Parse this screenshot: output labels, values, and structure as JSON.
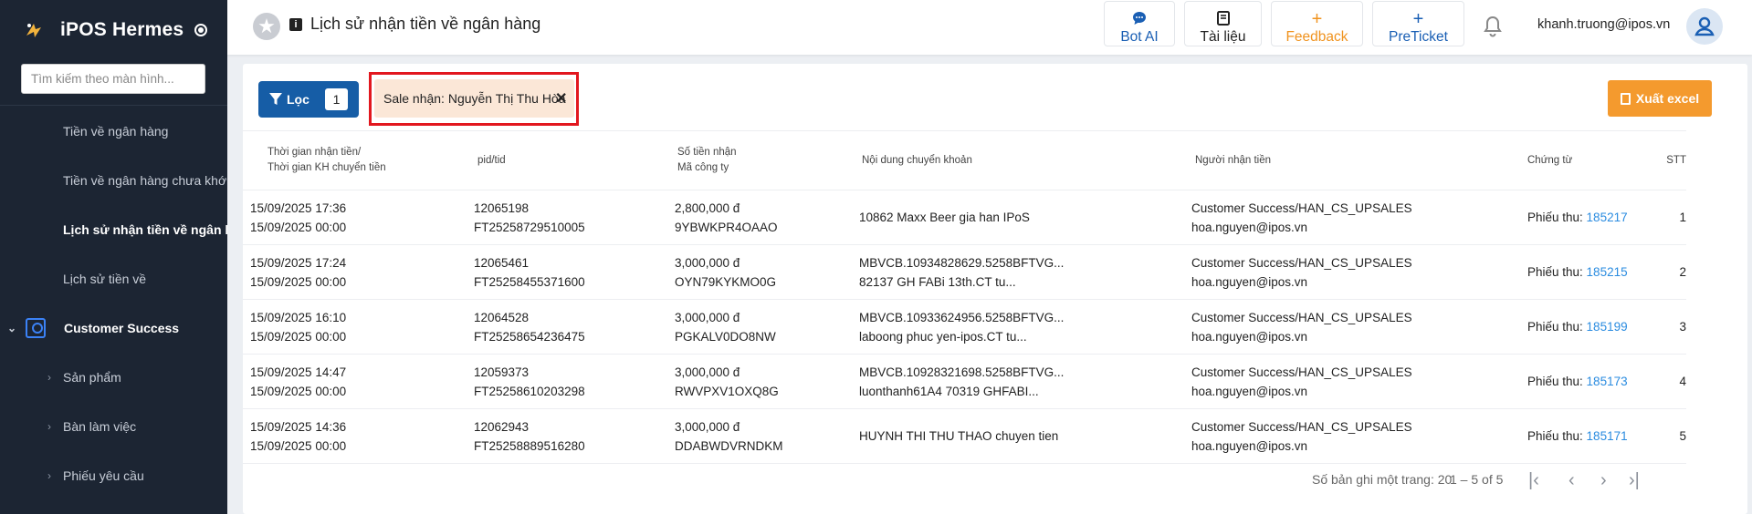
{
  "sidebar": {
    "brand": "iPOS Hermes",
    "search_placeholder": "Tìm kiếm theo màn hình...",
    "items": [
      {
        "label": "Tiền về ngân hàng"
      },
      {
        "label": "Tiền về ngân hàng chưa khớp"
      },
      {
        "label": "Lịch sử nhận tiền về ngân h..."
      },
      {
        "label": "Lịch sử tiền về"
      },
      {
        "label": "Customer Success"
      },
      {
        "label": "Sản phẩm"
      },
      {
        "label": "Bàn làm việc"
      },
      {
        "label": "Phiếu yêu cầu"
      }
    ]
  },
  "header": {
    "title": "Lịch sử nhận tiền về ngân hàng",
    "buttons": {
      "bot": "Bot AI",
      "docs": "Tài liệu",
      "feedback": "Feedback",
      "preticket": "PreTicket"
    },
    "user": "khanh.truong@ipos.vn"
  },
  "toolbar": {
    "filter_label": "Lọc",
    "filter_count": "1",
    "chip": "Sale nhận: Nguyễn Thị Thu Hòa",
    "export": "Xuất excel"
  },
  "table": {
    "headers": {
      "time1": "Thời gian nhận tiền/",
      "time2": "Thời gian KH chuyển tiền",
      "pid": "pid/tid",
      "amount1": "Số tiền nhận",
      "amount2": "Mã công ty",
      "content": "Nội dung chuyển khoản",
      "receiver": "Người nhận tiền",
      "voucher": "Chứng từ",
      "stt": "STT"
    },
    "rows": [
      {
        "t1": "15/09/2025 17:36",
        "t2": "15/09/2025 00:00",
        "pid": "12065198",
        "tid": "FT25258729510005",
        "amount": "2,800,000 đ",
        "company": "9YBWKPR4OAAO",
        "c1": "10862 Maxx Beer gia han IPoS",
        "c2": "",
        "r1": "Customer Success/HAN_CS_UPSALES",
        "r2": "hoa.nguyen@ipos.vn",
        "vlabel": "Phiếu thu: ",
        "vnum": "185217",
        "stt": "1"
      },
      {
        "t1": "15/09/2025 17:24",
        "t2": "15/09/2025 00:00",
        "pid": "12065461",
        "tid": "FT25258455371600",
        "amount": "3,000,000 đ",
        "company": "OYN79KYKMO0G",
        "c1": "MBVCB.10934828629.5258BFTVG...",
        "c2": "82137 GH FABi 13th.CT tu...",
        "r1": "Customer Success/HAN_CS_UPSALES",
        "r2": "hoa.nguyen@ipos.vn",
        "vlabel": "Phiếu thu: ",
        "vnum": "185215",
        "stt": "2"
      },
      {
        "t1": "15/09/2025 16:10",
        "t2": "15/09/2025 00:00",
        "pid": "12064528",
        "tid": "FT25258654236475",
        "amount": "3,000,000 đ",
        "company": "PGKALV0DO8NW",
        "c1": "MBVCB.10933624956.5258BFTVG...",
        "c2": "laboong phuc yen-ipos.CT tu...",
        "r1": "Customer Success/HAN_CS_UPSALES",
        "r2": "hoa.nguyen@ipos.vn",
        "vlabel": "Phiếu thu: ",
        "vnum": "185199",
        "stt": "3"
      },
      {
        "t1": "15/09/2025 14:47",
        "t2": "15/09/2025 00:00",
        "pid": "12059373",
        "tid": "FT25258610203298",
        "amount": "3,000,000 đ",
        "company": "RWVPXV1OXQ8G",
        "c1": "MBVCB.10928321698.5258BFTVG...",
        "c2": "luonthanh61A4 70319 GHFABI...",
        "r1": "Customer Success/HAN_CS_UPSALES",
        "r2": "hoa.nguyen@ipos.vn",
        "vlabel": "Phiếu thu: ",
        "vnum": "185173",
        "stt": "4"
      },
      {
        "t1": "15/09/2025 14:36",
        "t2": "15/09/2025 00:00",
        "pid": "12062943",
        "tid": "FT25258889516280",
        "amount": "3,000,000 đ",
        "company": "DDABWDVRNDKM",
        "c1": "HUYNH THI THU THAO chuyen tien",
        "c2": "",
        "r1": "Customer Success/HAN_CS_UPSALES",
        "r2": "hoa.nguyen@ipos.vn",
        "vlabel": "Phiếu thu: ",
        "vnum": "185171",
        "stt": "5"
      }
    ]
  },
  "pagination": {
    "rows_per_page_label": "Số bản ghi một trang:",
    "rows_per_page": "20",
    "range": "1 – 5 of 5"
  },
  "colors": {
    "sidebar_bg": "#1c2533",
    "primary": "#165da6",
    "export": "#f49a2e",
    "link": "#2b8ce0",
    "highlight": "#e2171e"
  }
}
